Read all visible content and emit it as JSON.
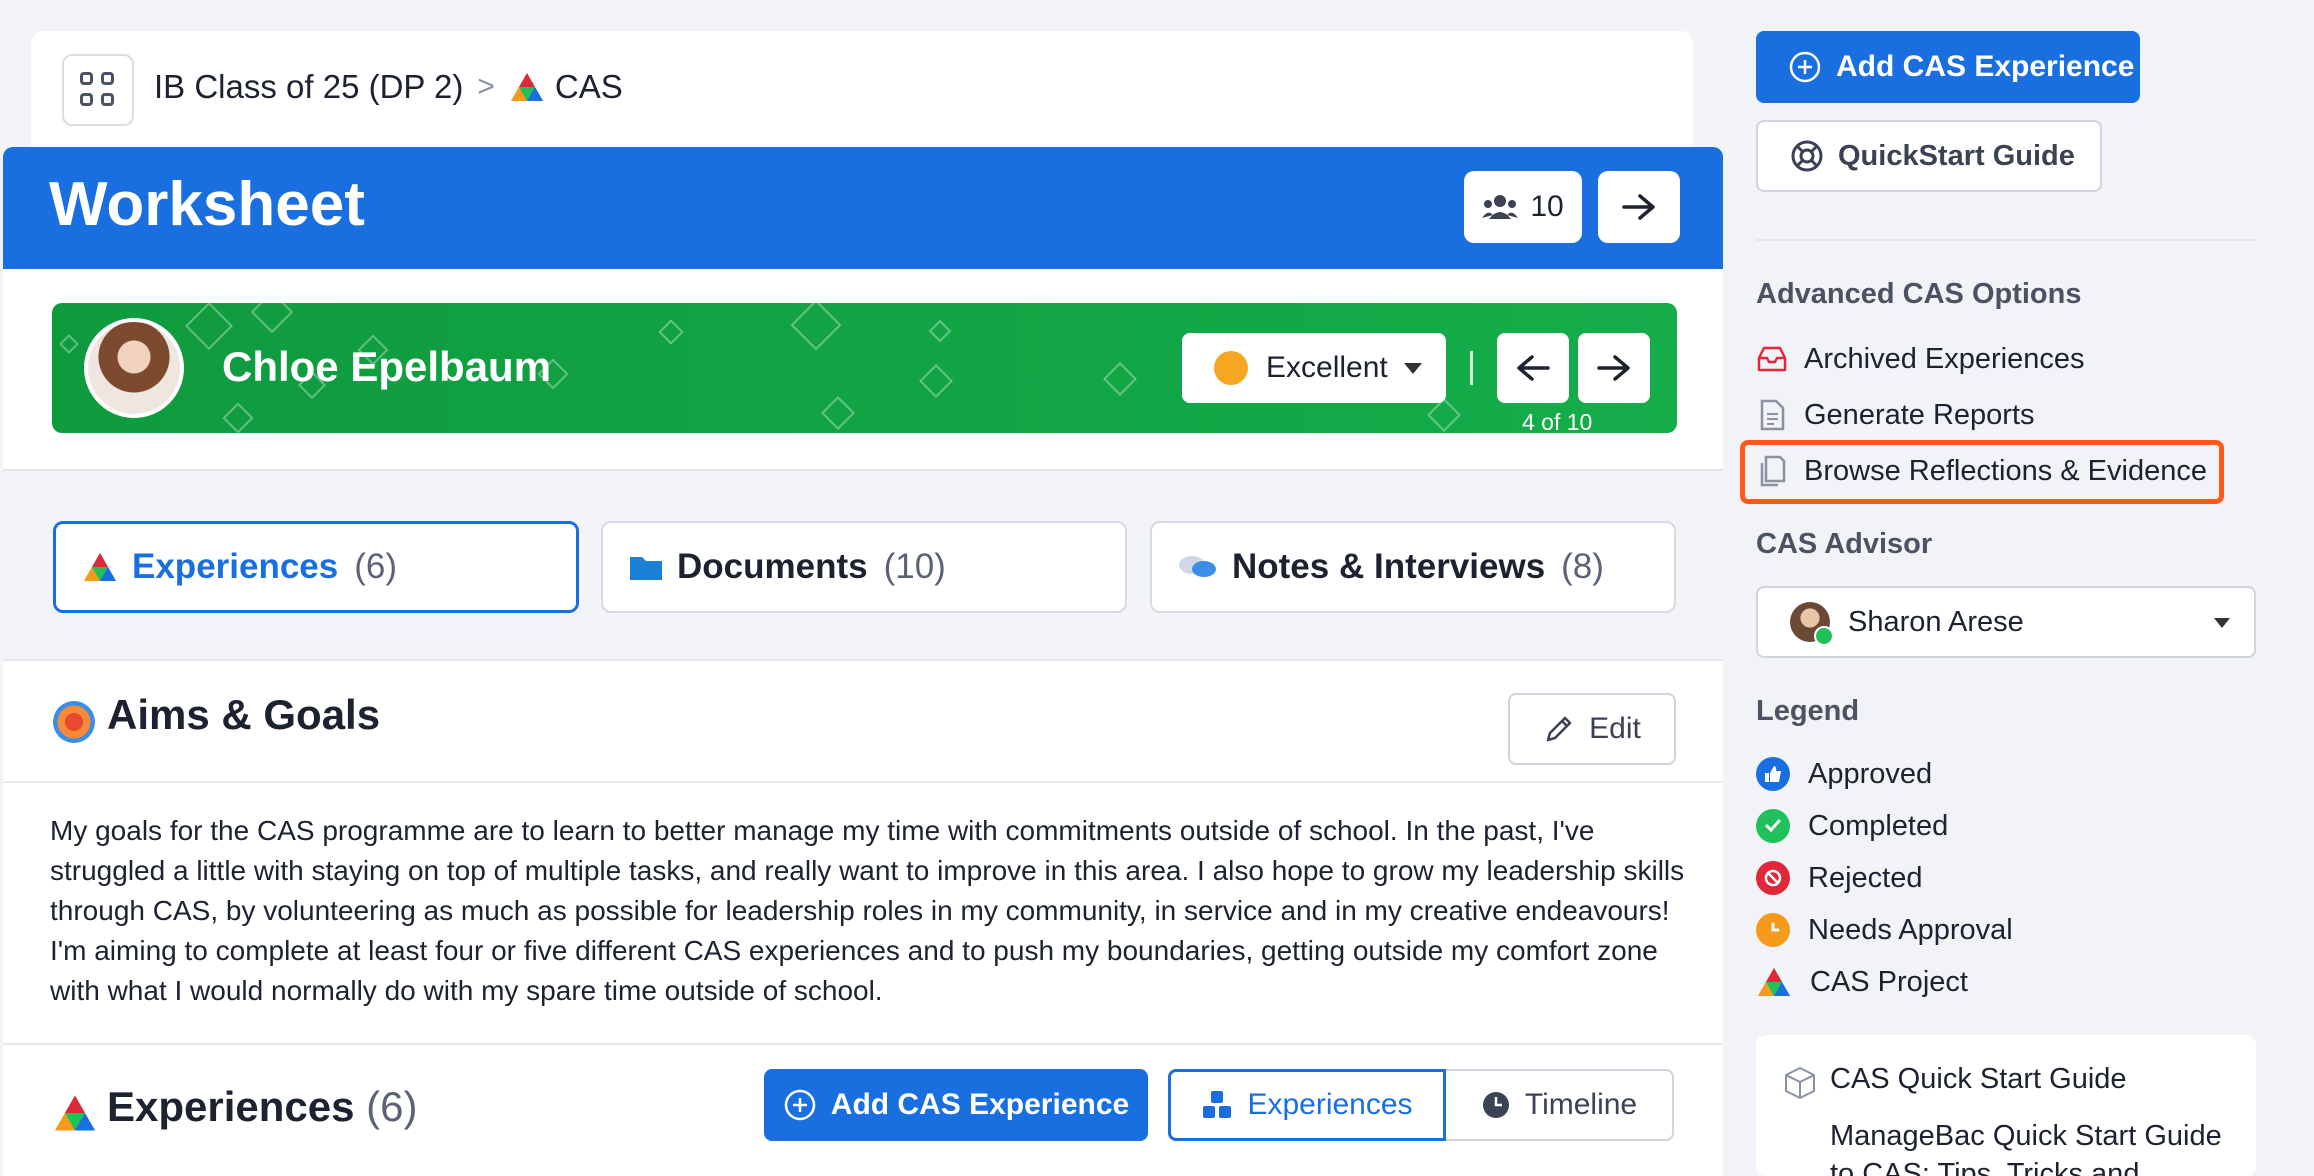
{
  "breadcrumb": {
    "class_name": "IB Class of 25 (DP 2)",
    "separator": ">",
    "section": "CAS"
  },
  "header": {
    "title": "Worksheet",
    "student_count": "10"
  },
  "student": {
    "name": "Chloe Epelbaum",
    "grade": "Excellent",
    "pager": "4 of 10"
  },
  "tabs": [
    {
      "label": "Experiences",
      "count": "(6)"
    },
    {
      "label": "Documents",
      "count": "(10)"
    },
    {
      "label": "Notes & Interviews",
      "count": "(8)"
    }
  ],
  "aims": {
    "title": "Aims & Goals",
    "edit_label": "Edit",
    "text": "My goals for the CAS programme are to learn to better manage my time with commitments outside of school. In the past, I've struggled a little with staying on top of multiple tasks, and really want to improve in this area. I also hope to grow my leadership skills through CAS, by volunteering as much as possible for leadership roles in my community, in service and in my creative endeavours! I'm aiming to complete at least four or five different CAS experiences and to push my boundaries, getting outside my comfort zone with what I would normally do with my spare time outside of school."
  },
  "experiences": {
    "title": "Experiences",
    "count": "(6)",
    "add_label": "Add CAS Experience",
    "view_experiences": "Experiences",
    "view_timeline": "Timeline"
  },
  "sidebar": {
    "add_label": "Add CAS Experience",
    "quickstart_label": "QuickStart Guide",
    "advanced_heading": "Advanced CAS Options",
    "links": [
      "Archived Experiences",
      "Generate Reports",
      "Browse Reflections & Evidence"
    ],
    "advisor_heading": "CAS Advisor",
    "advisor_name": "Sharon Arese",
    "legend_heading": "Legend",
    "legend": [
      {
        "label": "Approved",
        "color": "#1a6fe0"
      },
      {
        "label": "Completed",
        "color": "#20c05a"
      },
      {
        "label": "Rejected",
        "color": "#e0283a"
      },
      {
        "label": "Needs Approval",
        "color": "#f59a1a"
      },
      {
        "label": "CAS Project",
        "color": "#e0283a"
      }
    ],
    "guide_title": "CAS Quick Start Guide",
    "guide_text": "ManageBac Quick Start Guide to CAS: Tips, Tricks and"
  },
  "colors": {
    "primary": "#1a6fe0",
    "banner_green": "#14ad4a",
    "highlight": "#ff5a1a"
  }
}
